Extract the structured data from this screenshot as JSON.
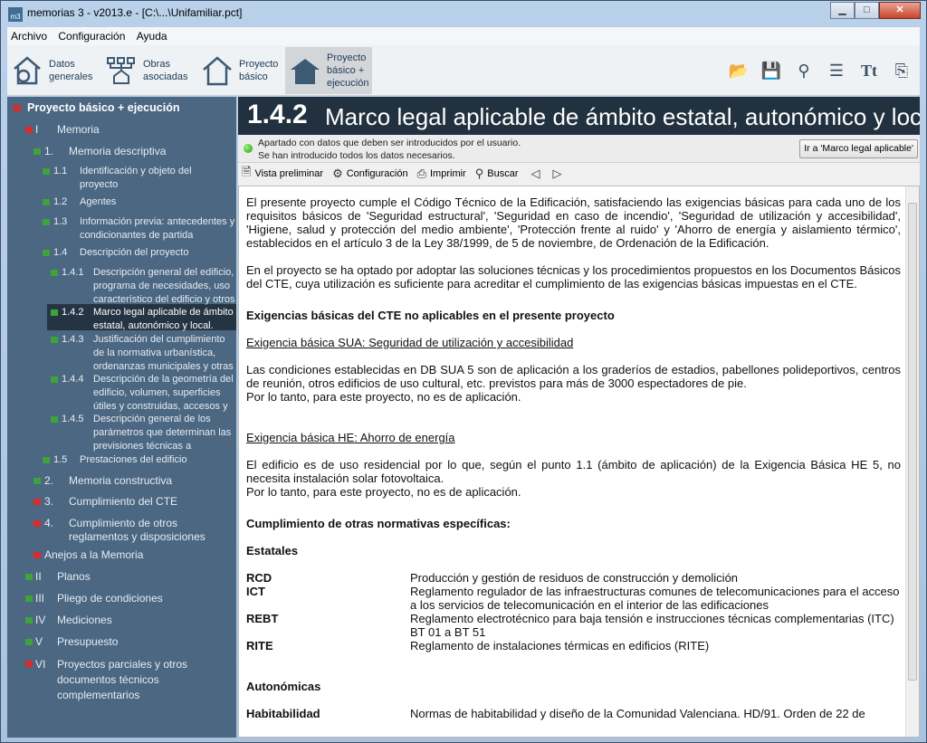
{
  "window": {
    "title": "memorias 3 - v2013.e - [C:\\...\\Unifamiliar.pct]",
    "app_icon": "m3",
    "min": "▁",
    "max": "□",
    "close": "✕"
  },
  "menu": [
    "Archivo",
    "Configuración",
    "Ayuda"
  ],
  "toolbar": {
    "datos": [
      "Datos",
      "generales"
    ],
    "obras": [
      "Obras",
      "asociadas"
    ],
    "basico": [
      "Proyecto",
      "básico"
    ],
    "ejec": [
      "Proyecto",
      "básico +",
      "ejecución"
    ]
  },
  "tree": {
    "root": "Proyecto básico + ejecución",
    "items": [
      {
        "num": "I",
        "text": "Memoria"
      },
      {
        "num": "1.",
        "text": "Memoria descriptiva"
      },
      {
        "num": "1.1",
        "text": "Identificación y objeto del proyecto"
      },
      {
        "num": "1.2",
        "text": "Agentes"
      },
      {
        "num": "1.3",
        "text": "Información previa: antecedentes y condicionantes de partida"
      },
      {
        "num": "1.4",
        "text": "Descripción del proyecto"
      },
      {
        "num": "1.4.1",
        "text": "Descripción general del edificio, programa de necesidades, uso característico del edificio y otros"
      },
      {
        "num": "1.4.2",
        "text": "Marco legal aplicable de ámbito estatal, autonómico y local."
      },
      {
        "num": "1.4.3",
        "text": "Justificación del cumplimiento de la normativa urbanística, ordenanzas municipales y otras"
      },
      {
        "num": "1.4.4",
        "text": "Descripción de la geometría del edificio, volumen, superficies útiles y construidas, accesos y"
      },
      {
        "num": "1.4.5",
        "text": "Descripción general de los parámetros que determinan las previsiones técnicas a considerar"
      },
      {
        "num": "1.5",
        "text": "Prestaciones del edificio"
      },
      {
        "num": "2.",
        "text": "Memoria constructiva"
      },
      {
        "num": "3.",
        "text": "Cumplimiento del CTE"
      },
      {
        "num": "4.",
        "text": "Cumplimiento de otros reglamentos y disposiciones"
      },
      {
        "num": "",
        "text": "Anejos a la Memoria"
      },
      {
        "num": "II",
        "text": "Planos"
      },
      {
        "num": "III",
        "text": "Pliego de condiciones"
      },
      {
        "num": "IV",
        "text": "Mediciones"
      },
      {
        "num": "V",
        "text": "Presupuesto"
      },
      {
        "num": "VI",
        "text": "Proyectos parciales y otros documentos técnicos complementarios"
      }
    ]
  },
  "header": {
    "num": "1.4.2",
    "title": "Marco legal aplicable de ámbito estatal, autonómico y local."
  },
  "status": {
    "line1": "Apartado con datos que deben ser introducidos por el usuario.",
    "line2": "Se han introducido todos los datos necesarios.",
    "goto": "Ir a 'Marco legal aplicable'"
  },
  "doctoolbar": {
    "preview": "Vista preliminar",
    "config": "Configuración",
    "print": "Imprimir",
    "search": "Buscar"
  },
  "doc": {
    "p1": "El presente proyecto cumple el Código Técnico de la Edificación, satisfaciendo las exigencias básicas para cada uno de los requisitos básicos de 'Seguridad estructural', 'Seguridad en caso de incendio', 'Seguridad de utilización y accesibilidad', 'Higiene, salud y protección del medio ambiente', 'Protección frente al ruido' y 'Ahorro de energía y aislamiento térmico', establecidos en el artículo 3 de la Ley 38/1999, de 5 de noviembre, de Ordenación de la Edificación.",
    "p2": "En el proyecto se ha optado por adoptar las soluciones técnicas y los procedimientos propuestos en los Documentos Básicos del CTE, cuya utilización es suficiente para acreditar el cumplimiento de las exigencias básicas impuestas en el CTE.",
    "h1": "Exigencias básicas del CTE no aplicables en el presente proyecto",
    "sua_title": "Exigencia básica SUA: Seguridad de utilización y accesibilidad",
    "sua_p": "Las condiciones establecidas en DB SUA 5 son de aplicación a los graderíos de estadios, pabellones polideportivos, centros de reunión, otros edificios de uso cultural, etc. previstos para más de 3000 espectadores de pie.",
    "sua_p2": "Por lo tanto, para este proyecto, no es de aplicación.",
    "he_title": "Exigencia básica HE: Ahorro de energía",
    "he_p": "El edificio es de uso residencial por lo que, según el punto 1.1 (ámbito de aplicación) de la Exigencia Básica HE 5, no necesita instalación solar fotovoltaica.",
    "he_p2": "Por lo tanto, para este proyecto, no es de aplicación.",
    "h2": "Cumplimiento de otras normativas específicas:",
    "estatales": "Estatales",
    "rows": [
      {
        "k": "RCD",
        "v": "Producción y gestión de residuos de construcción y demolición"
      },
      {
        "k": "ICT",
        "v": "Reglamento regulador de las infraestructuras comunes de telecomunicaciones para el acceso a los servicios de telecomunicación en el interior de las edificaciones"
      },
      {
        "k": "REBT",
        "v": "Reglamento electrotécnico para baja tensión e instrucciones técnicas complementarias (ITC) BT 01 a BT 51"
      },
      {
        "k": "RITE",
        "v": "Reglamento de instalaciones térmicas en edificios (RITE)"
      }
    ],
    "autonomicas": "Autonómicas",
    "hab_k": "Habitabilidad",
    "hab_v": "Normas de habitabilidad y diseño de la Comunidad Valenciana. HD/91. Orden de 22 de"
  }
}
